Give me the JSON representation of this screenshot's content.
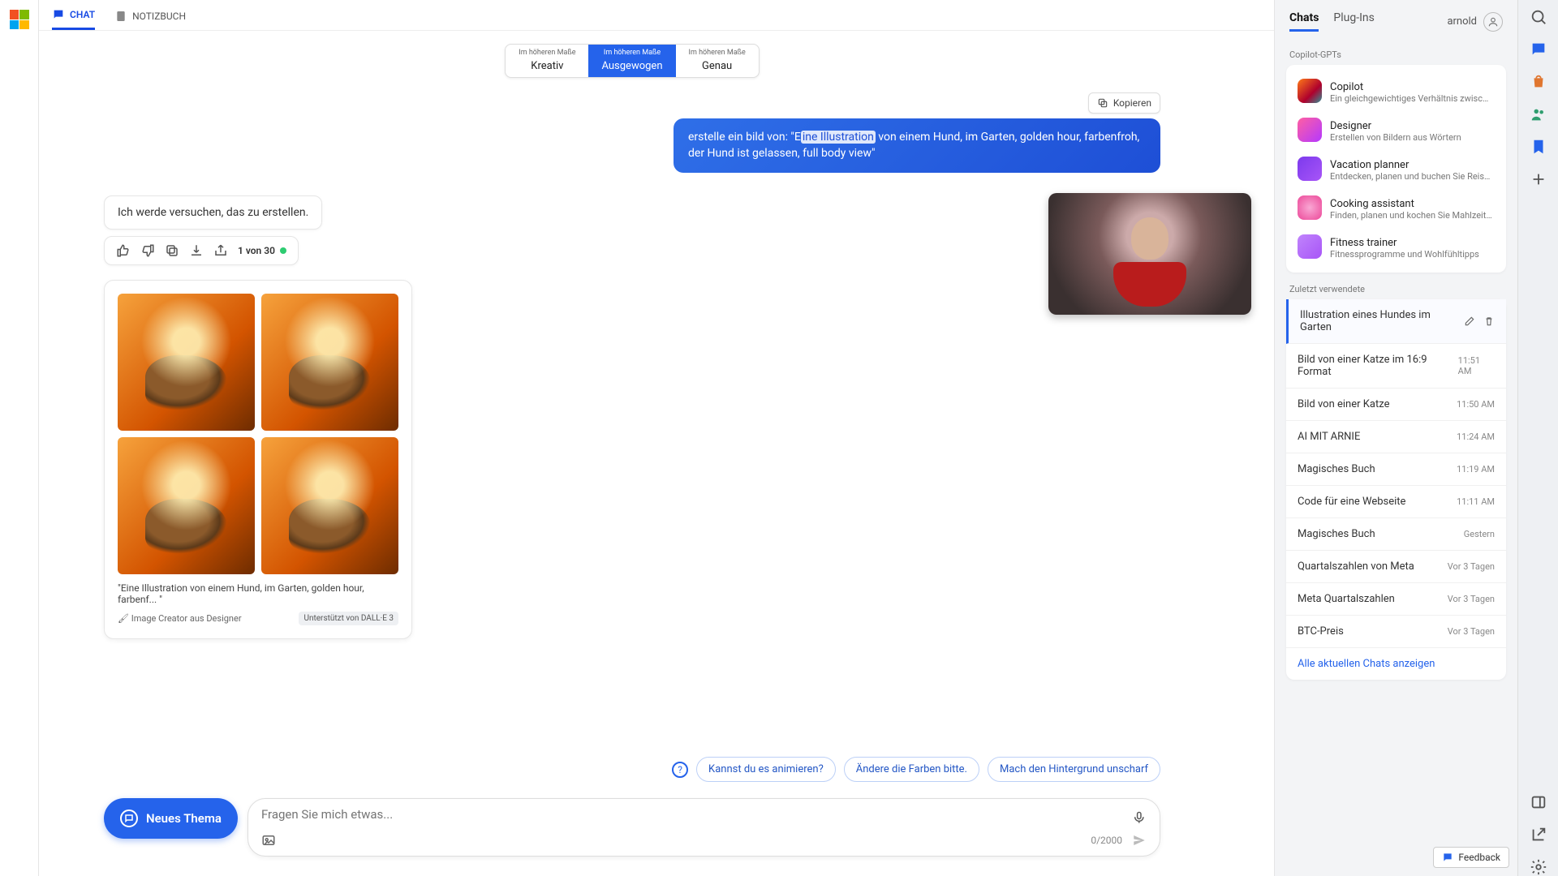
{
  "tabs": {
    "chat": "CHAT",
    "notebook": "NOTIZBUCH"
  },
  "styles": {
    "prefix": "Im höheren Maße",
    "creative": "Kreativ",
    "balanced": "Ausgewogen",
    "precise": "Genau"
  },
  "copy_label": "Kopieren",
  "user_message": {
    "pre": "erstelle ein bild von: \"E",
    "highlight": "ine Illustration",
    "post": " von einem Hund, im Garten, golden hour, farbenfroh, der Hund ist gelassen, full body view\""
  },
  "assistant_text": "Ich werde versuchen, das zu erstellen.",
  "counter": "1 von 30",
  "caption": "\"Eine Illustration von einem Hund, im Garten, golden hour, farbenf... \"",
  "credit": "Image Creator aus Designer",
  "dalle_badge": "Unterstützt von DALL·E 3",
  "suggestions": {
    "s1": "Kannst du es animieren?",
    "s2": "Ändere die Farben bitte.",
    "s3": "Mach den Hintergrund unscharf"
  },
  "new_topic": "Neues Thema",
  "input_placeholder": "Fragen Sie mich etwas...",
  "char_counter": "0/2000",
  "right": {
    "tab_chats": "Chats",
    "tab_plugins": "Plug-Ins",
    "user": "arnold",
    "sec_gpts": "Copilot-GPTs",
    "gpts": [
      {
        "name": "Copilot",
        "desc": "Ein gleichgewichtiges Verhältnis zwischen KI u",
        "color": "linear-gradient(135deg,#ff7a18,#af002d 60%,#319197)"
      },
      {
        "name": "Designer",
        "desc": "Erstellen von Bildern aus Wörtern",
        "color": "linear-gradient(135deg,#ff5fa2,#b438ff)"
      },
      {
        "name": "Vacation planner",
        "desc": "Entdecken, planen und buchen Sie Reisen",
        "color": "linear-gradient(135deg,#7c3aed,#a855f7)"
      },
      {
        "name": "Cooking assistant",
        "desc": "Finden, planen und kochen Sie Mahlzeiten",
        "color": "radial-gradient(circle,#f9a8d4,#ec4899)"
      },
      {
        "name": "Fitness trainer",
        "desc": "Fitnessprogramme und Wohlfühltipps",
        "color": "linear-gradient(135deg,#c084fc,#a855f7)"
      }
    ],
    "sec_recent": "Zuletzt verwendete",
    "recent": [
      {
        "title": "Illustration eines Hundes im Garten",
        "time": "",
        "active": true
      },
      {
        "title": "Bild von einer Katze im 16:9 Format",
        "time": "11:51 AM"
      },
      {
        "title": "Bild von einer Katze",
        "time": "11:50 AM"
      },
      {
        "title": "AI MIT ARNIE",
        "time": "11:24 AM"
      },
      {
        "title": "Magisches Buch",
        "time": "11:19 AM"
      },
      {
        "title": "Code für eine Webseite",
        "time": "11:11 AM"
      },
      {
        "title": "Magisches Buch",
        "time": "Gestern"
      },
      {
        "title": "Quartalszahlen von Meta",
        "time": "Vor 3 Tagen"
      },
      {
        "title": "Meta Quartalszahlen",
        "time": "Vor 3 Tagen"
      },
      {
        "title": "BTC-Preis",
        "time": "Vor 3 Tagen"
      }
    ],
    "show_all": "Alle aktuellen Chats anzeigen"
  },
  "feedback": "Feedback"
}
